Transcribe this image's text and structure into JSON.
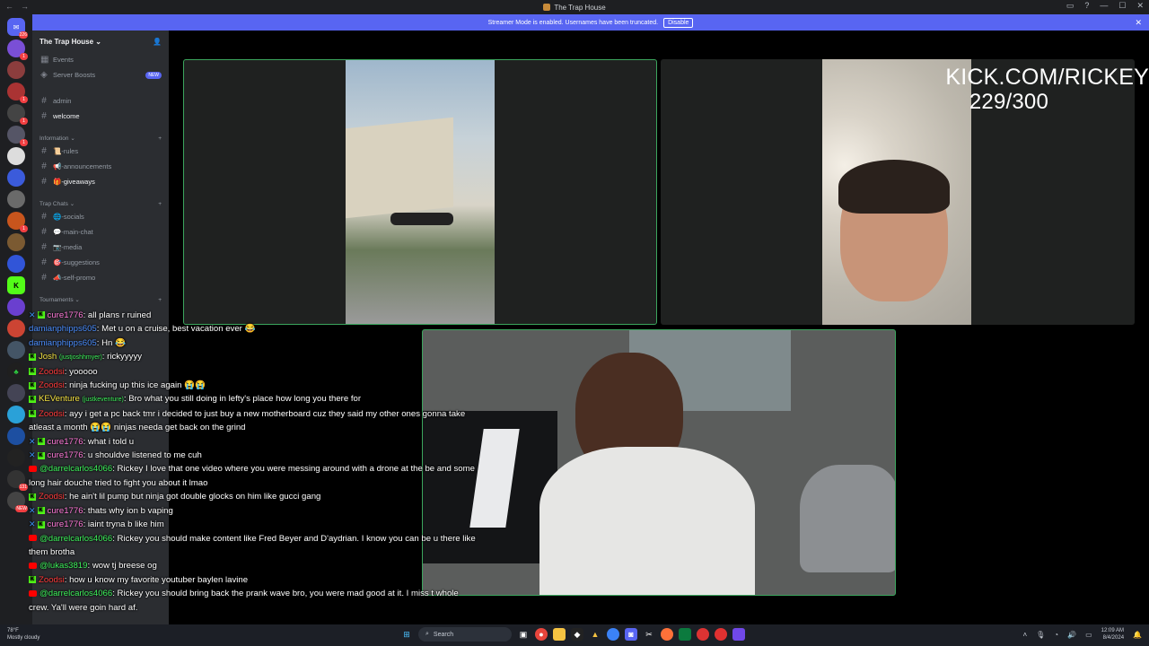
{
  "window": {
    "title": "The Trap House",
    "controls": [
      "—",
      "☐",
      "✕"
    ]
  },
  "streamer_banner": {
    "text": "Streamer Mode is enabled. Usernames have been truncated.",
    "button": "Disable"
  },
  "server_rail": {
    "top_badge": "226",
    "badges": [
      "1",
      "1",
      "1",
      "1",
      "1",
      "1",
      "131"
    ],
    "new_label": "NEW"
  },
  "guild": {
    "name": "The Trap House",
    "top_items": [
      {
        "label": "Events",
        "icon": "calendar-icon"
      },
      {
        "label": "Server Boosts",
        "icon": "boost-icon",
        "badge": "NEW"
      }
    ],
    "channels": [
      {
        "label": "admin",
        "active": false
      },
      {
        "label": "welcome",
        "active": true
      }
    ],
    "categories": [
      {
        "name": "Information",
        "channels": [
          {
            "label": "📜-rules",
            "active": false
          },
          {
            "label": "📢-announcements",
            "active": false
          },
          {
            "label": "🎁-giveaways",
            "active": true
          }
        ]
      },
      {
        "name": "Trap Chats",
        "channels": [
          {
            "label": "🌐-socials",
            "active": false
          },
          {
            "label": "💬-main-chat",
            "active": false
          },
          {
            "label": "📷-media",
            "active": false
          },
          {
            "label": "🎯-suggestions",
            "active": false
          },
          {
            "label": "📣-self-promo",
            "active": false
          }
        ]
      },
      {
        "name": "Tournaments",
        "channels": []
      }
    ]
  },
  "overlay": {
    "kick_url": "KICK.COM/RICKEY",
    "counter": "229/300"
  },
  "video_tiles": [
    {
      "name": "truck-video",
      "speaking": true
    },
    {
      "name": "face-cam-right",
      "speaking": false
    },
    {
      "name": "main-streamer-cam",
      "speaking": true
    }
  ],
  "chat": [
    {
      "badges": [
        "x",
        "k"
      ],
      "user": "cure1776",
      "color": "user-pink",
      "text": "all plans r ruined"
    },
    {
      "badges": [],
      "user": "damianphipps605",
      "color": "user-blue",
      "text": "Met u on a cruise, best vacation ever 😂"
    },
    {
      "badges": [],
      "user": "damianphipps605",
      "color": "user-blue",
      "text": "Hn 😂"
    },
    {
      "badges": [
        "k"
      ],
      "user": "Josh",
      "color": "user-yellow",
      "sub": "(justjoshhmyer)",
      "text": "rickyyyyy"
    },
    {
      "badges": [
        "k"
      ],
      "user": "Zoodsi",
      "color": "user-red",
      "text": "yooooo"
    },
    {
      "badges": [
        "k"
      ],
      "user": "Zoodsi",
      "color": "user-red",
      "text": "ninja fucking up this ice again 😭😭"
    },
    {
      "badges": [
        "k"
      ],
      "user": "KEVenture",
      "color": "user-yellow",
      "sub": "(justkeventure)",
      "text": "Bro what you still doing in lefty's place how long you there for"
    },
    {
      "badges": [
        "k"
      ],
      "user": "Zoodsi",
      "color": "user-red",
      "text": "ayy i get a pc back tmr i decided to just buy a new motherboard cuz they said my other ones gonna take atleast a month 😭😭 ninjas needa get back on the grind"
    },
    {
      "badges": [
        "x",
        "k"
      ],
      "user": "cure1776",
      "color": "user-pink",
      "text": "what i told u"
    },
    {
      "badges": [
        "x",
        "k"
      ],
      "user": "cure1776",
      "color": "user-pink",
      "text": "u shouldve listened to me cuh"
    },
    {
      "badges": [
        "yt"
      ],
      "user": "@darrelcarlos4066",
      "color": "user-green",
      "text": "Rickey I love that one video where you were messing around with a drone at the be and some long hair douche tried to fight you about it lmao"
    },
    {
      "badges": [
        "k"
      ],
      "user": "Zoodsi",
      "color": "user-red",
      "text": "he ain't lil pump but ninja got double glocks on him like gucci gang"
    },
    {
      "badges": [
        "x",
        "k"
      ],
      "user": "cure1776",
      "color": "user-pink",
      "text": "thats why ion b vaping"
    },
    {
      "badges": [
        "x",
        "k"
      ],
      "user": "cure1776",
      "color": "user-pink",
      "text": "iaint tryna b like him"
    },
    {
      "badges": [
        "yt"
      ],
      "user": "@darrelcarlos4066",
      "color": "user-green",
      "text": "Rickey you should make content like Fred Beyer and D'aydrian. I know you can be u there like them brotha"
    },
    {
      "badges": [
        "yt"
      ],
      "user": "@lukas3819",
      "color": "user-green",
      "text": "wow tj breese og"
    },
    {
      "badges": [
        "k"
      ],
      "user": "Zoodsi",
      "color": "user-red",
      "text": "how u know my favorite youtuber baylen lavine"
    },
    {
      "badges": [
        "yt"
      ],
      "user": "@darrelcarlos4066",
      "color": "user-green",
      "text": "Rickey you should bring back the prank wave bro, you were mad good at it. I miss t whole crew. Ya'll were goin hard af."
    }
  ],
  "taskbar": {
    "weather_temp": "78°F",
    "weather_desc": "Mostly cloudy",
    "search_placeholder": "Search",
    "time": "12:09 AM",
    "date": "8/4/2024"
  }
}
